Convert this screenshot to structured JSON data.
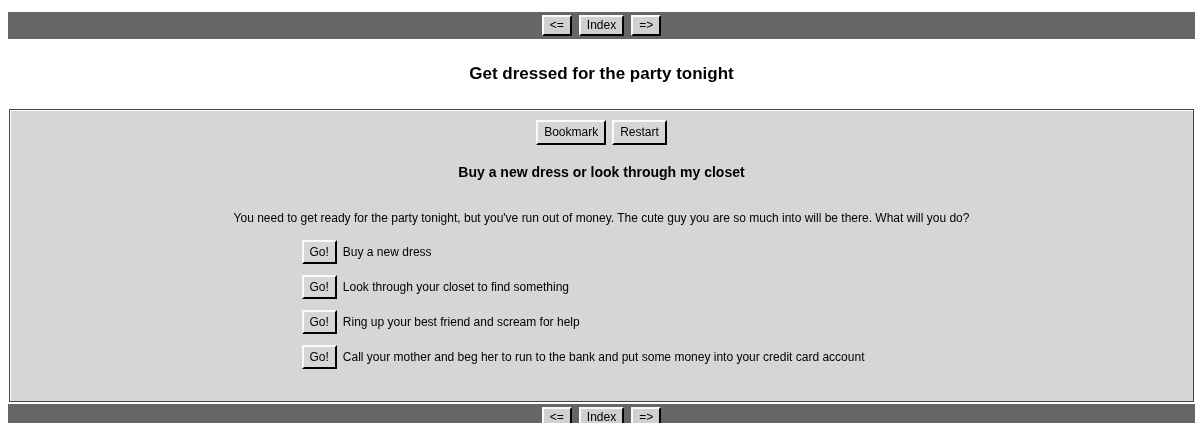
{
  "top_nav": {
    "buttons": [
      "<=",
      "Index",
      "=>"
    ]
  },
  "title": "Get dressed for the party tonight",
  "panel": {
    "buttons": [
      "Bookmark",
      "Restart"
    ],
    "heading": "Buy a new dress or look through my closet",
    "text": "You need to get ready for the party tonight, but you've run out of money. The cute guy you are so much into will be there. What will you do?",
    "choices": [
      {
        "button": "Go!",
        "label": "Buy a new dress"
      },
      {
        "button": "Go!",
        "label": "Look through your closet to find something"
      },
      {
        "button": "Go!",
        "label": "Ring up your best friend and scream for help"
      },
      {
        "button": "Go!",
        "label": "Call your mother and beg her to run to the bank and put some money into your credit card account"
      }
    ]
  },
  "bottom_nav": {
    "buttons": [
      "<=",
      "Index",
      "=>"
    ]
  }
}
